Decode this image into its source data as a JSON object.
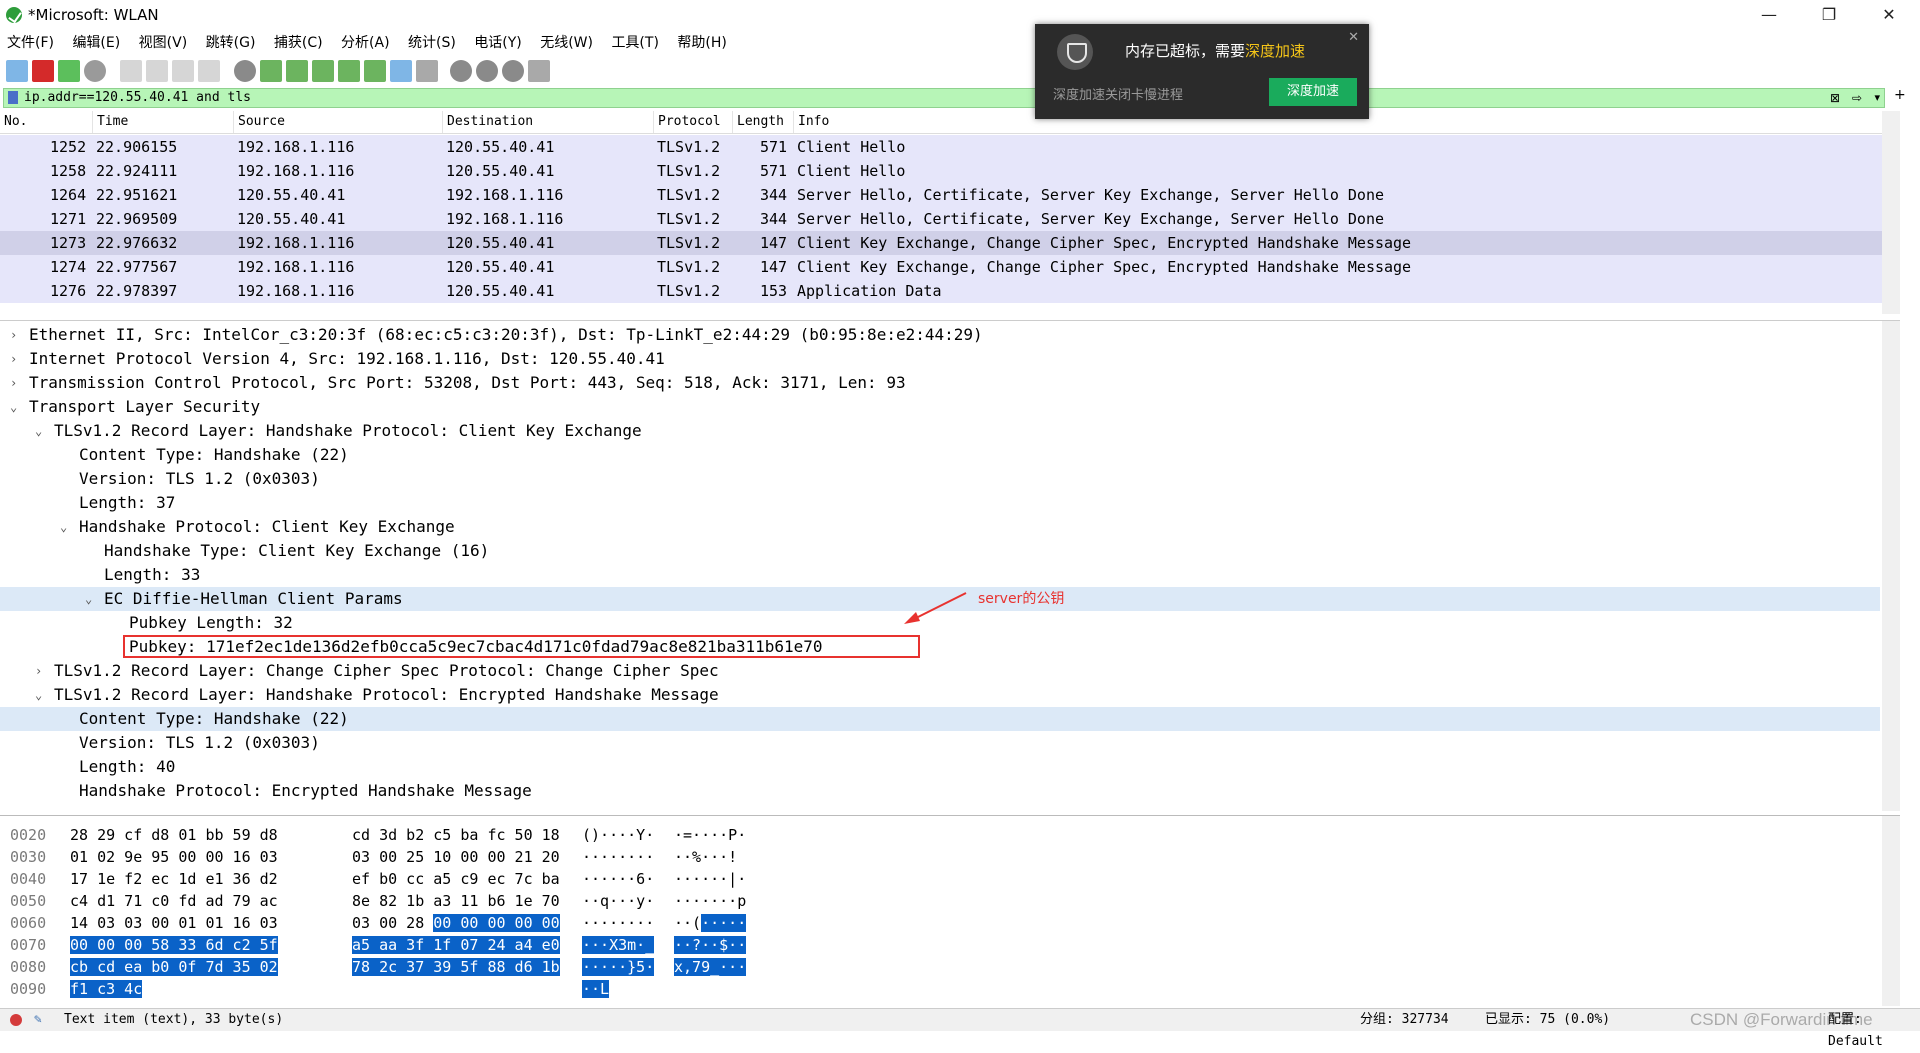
{
  "window": {
    "title": "*Microsoft: WLAN",
    "minimize": "—",
    "maximize": "❐",
    "close": "✕"
  },
  "menu": [
    "文件(F)",
    "编辑(E)",
    "视图(V)",
    "跳转(G)",
    "捕获(C)",
    "分析(A)",
    "统计(S)",
    "电话(Y)",
    "无线(W)",
    "工具(T)",
    "帮助(H)"
  ],
  "filter": {
    "value": "ip.addr==120.55.40.41 and tls"
  },
  "packet_list": {
    "columns": [
      "No.",
      "Time",
      "Source",
      "Destination",
      "Protocol",
      "Length",
      "Info"
    ],
    "rows": [
      {
        "no": "1252",
        "time": "22.906155",
        "src": "192.168.1.116",
        "dst": "120.55.40.41",
        "proto": "TLSv1.2",
        "len": "571",
        "info": "Client Hello"
      },
      {
        "no": "1258",
        "time": "22.924111",
        "src": "192.168.1.116",
        "dst": "120.55.40.41",
        "proto": "TLSv1.2",
        "len": "571",
        "info": "Client Hello"
      },
      {
        "no": "1264",
        "time": "22.951621",
        "src": "120.55.40.41",
        "dst": "192.168.1.116",
        "proto": "TLSv1.2",
        "len": "344",
        "info": "Server Hello, Certificate, Server Key Exchange, Server Hello Done"
      },
      {
        "no": "1271",
        "time": "22.969509",
        "src": "120.55.40.41",
        "dst": "192.168.1.116",
        "proto": "TLSv1.2",
        "len": "344",
        "info": "Server Hello, Certificate, Server Key Exchange, Server Hello Done"
      },
      {
        "no": "1273",
        "time": "22.976632",
        "src": "192.168.1.116",
        "dst": "120.55.40.41",
        "proto": "TLSv1.2",
        "len": "147",
        "info": "Client Key Exchange, Change Cipher Spec, Encrypted Handshake Message"
      },
      {
        "no": "1274",
        "time": "22.977567",
        "src": "192.168.1.116",
        "dst": "120.55.40.41",
        "proto": "TLSv1.2",
        "len": "147",
        "info": "Client Key Exchange, Change Cipher Spec, Encrypted Handshake Message"
      },
      {
        "no": "1276",
        "time": "22.978397",
        "src": "192.168.1.116",
        "dst": "120.55.40.41",
        "proto": "TLSv1.2",
        "len": "153",
        "info": "Application Data"
      }
    ]
  },
  "details": [
    {
      "arrow": "›",
      "text": "Ethernet II, Src: IntelCor_c3:20:3f (68:ec:c5:c3:20:3f), Dst: Tp-LinkT_e2:44:29 (b0:95:8e:e2:44:29)"
    },
    {
      "arrow": "›",
      "text": "Internet Protocol Version 4, Src: 192.168.1.116, Dst: 120.55.40.41"
    },
    {
      "arrow": "›",
      "text": "Transmission Control Protocol, Src Port: 53208, Dst Port: 443, Seq: 518, Ack: 3171, Len: 93"
    },
    {
      "arrow": "⌄",
      "text": "Transport Layer Security"
    },
    {
      "arrow": "⌄",
      "text": "TLSv1.2 Record Layer: Handshake Protocol: Client Key Exchange"
    },
    {
      "arrow": "",
      "text": "Content Type: Handshake (22)"
    },
    {
      "arrow": "",
      "text": "Version: TLS 1.2 (0x0303)"
    },
    {
      "arrow": "",
      "text": "Length: 37"
    },
    {
      "arrow": "⌄",
      "text": "Handshake Protocol: Client Key Exchange"
    },
    {
      "arrow": "",
      "text": "Handshake Type: Client Key Exchange (16)"
    },
    {
      "arrow": "",
      "text": "Length: 33"
    },
    {
      "arrow": "⌄",
      "text": "EC Diffie-Hellman Client Params"
    },
    {
      "arrow": "",
      "text": "Pubkey Length: 32"
    },
    {
      "arrow": "",
      "text": "Pubkey: 171ef2ec1de136d2efb0cca5c9ec7cbac4d171c0fdad79ac8e821ba311b61e70"
    },
    {
      "arrow": "›",
      "text": "TLSv1.2 Record Layer: Change Cipher Spec Protocol: Change Cipher Spec"
    },
    {
      "arrow": "⌄",
      "text": "TLSv1.2 Record Layer: Handshake Protocol: Encrypted Handshake Message"
    },
    {
      "arrow": "",
      "text": "Content Type: Handshake (22)"
    },
    {
      "arrow": "",
      "text": "Version: TLS 1.2 (0x0303)"
    },
    {
      "arrow": "",
      "text": "Length: 40"
    },
    {
      "arrow": "",
      "text": "Handshake Protocol: Encrypted Handshake Message"
    }
  ],
  "annotation": "server的公钥",
  "hex": [
    {
      "off": "0020",
      "a": "28 29 cf d8 01 bb 59 d8",
      "a_sel": "",
      "b": "cd 3d b2 c5 ba fc 50 18",
      "b_sel": "",
      "asc1": "()····Y·",
      "asc1_sel": "",
      "asc2": "·=····P·",
      "asc2_sel": ""
    },
    {
      "off": "0030",
      "a": "01 02 9e 95 00 00 16 03",
      "a_sel": "",
      "b": "03 00 25 10 00 00 21 20",
      "b_sel": "",
      "asc1": "········",
      "asc1_sel": "",
      "asc2": "··%···!",
      "asc2_sel": ""
    },
    {
      "off": "0040",
      "a": "17 1e f2 ec 1d e1 36 d2",
      "a_sel": "",
      "b": "ef b0 cc a5 c9 ec 7c ba",
      "b_sel": "",
      "asc1": "······6·",
      "asc1_sel": "",
      "asc2": "······|·",
      "asc2_sel": ""
    },
    {
      "off": "0050",
      "a": "c4 d1 71 c0 fd ad 79 ac",
      "a_sel": "",
      "b": "8e 82 1b a3 11 b6 1e 70",
      "b_sel": "",
      "asc1": "··q···y·",
      "asc1_sel": "",
      "asc2": "·······p",
      "asc2_sel": ""
    },
    {
      "off": "0060",
      "a": "14 03 03 00 01 01 16 03",
      "a_sel": "",
      "b": "03 00 28 ",
      "b_sel": "00 00 00 00 00",
      "asc1": "········",
      "asc1_sel": "",
      "asc2": "··(",
      "asc2_sel": "·····"
    },
    {
      "off": "0070",
      "a": "",
      "a_sel": "00 00 00 58 33 6d c2 5f",
      "b": "",
      "b_sel": "a5 aa 3f 1f 07 24 a4 e0",
      "asc1": "",
      "asc1_sel": "···X3m·_",
      "asc2": "",
      "asc2_sel": "··?··$··"
    },
    {
      "off": "0080",
      "a": "",
      "a_sel": "cb cd ea b0 0f 7d 35 02",
      "b": "",
      "b_sel": "78 2c 37 39 5f 88 d6 1b",
      "asc1": "",
      "asc1_sel": "·····}5·",
      "asc2": "",
      "asc2_sel": "x,79_···"
    },
    {
      "off": "0090",
      "a": "",
      "a_sel": "f1 c3 4c",
      "b": "",
      "b_sel": "",
      "asc1": "",
      "asc1_sel": "··L",
      "asc2": "",
      "asc2_sel": ""
    }
  ],
  "status": {
    "left": "Text item (text), 33 byte(s)",
    "packets": "分组: 327734",
    "displayed": "已显示: 75 (0.0%)",
    "profile": "配置: Default",
    "watermark": "CSDN @Forwardin time"
  },
  "popup": {
    "title_prefix": "内存已超标，需要",
    "title_link": "深度加速",
    "subtitle": "深度加速关闭卡慢进程",
    "button": "深度加速",
    "close": "✕"
  },
  "colors": {
    "row_bg": "#e6e6fa",
    "selected_row": "#d0d0e8",
    "filter_bg": "#b7f5b7",
    "hex_sel": "#0a62c8",
    "annotation": "#e8322f",
    "popup_button": "#1aab5c"
  }
}
